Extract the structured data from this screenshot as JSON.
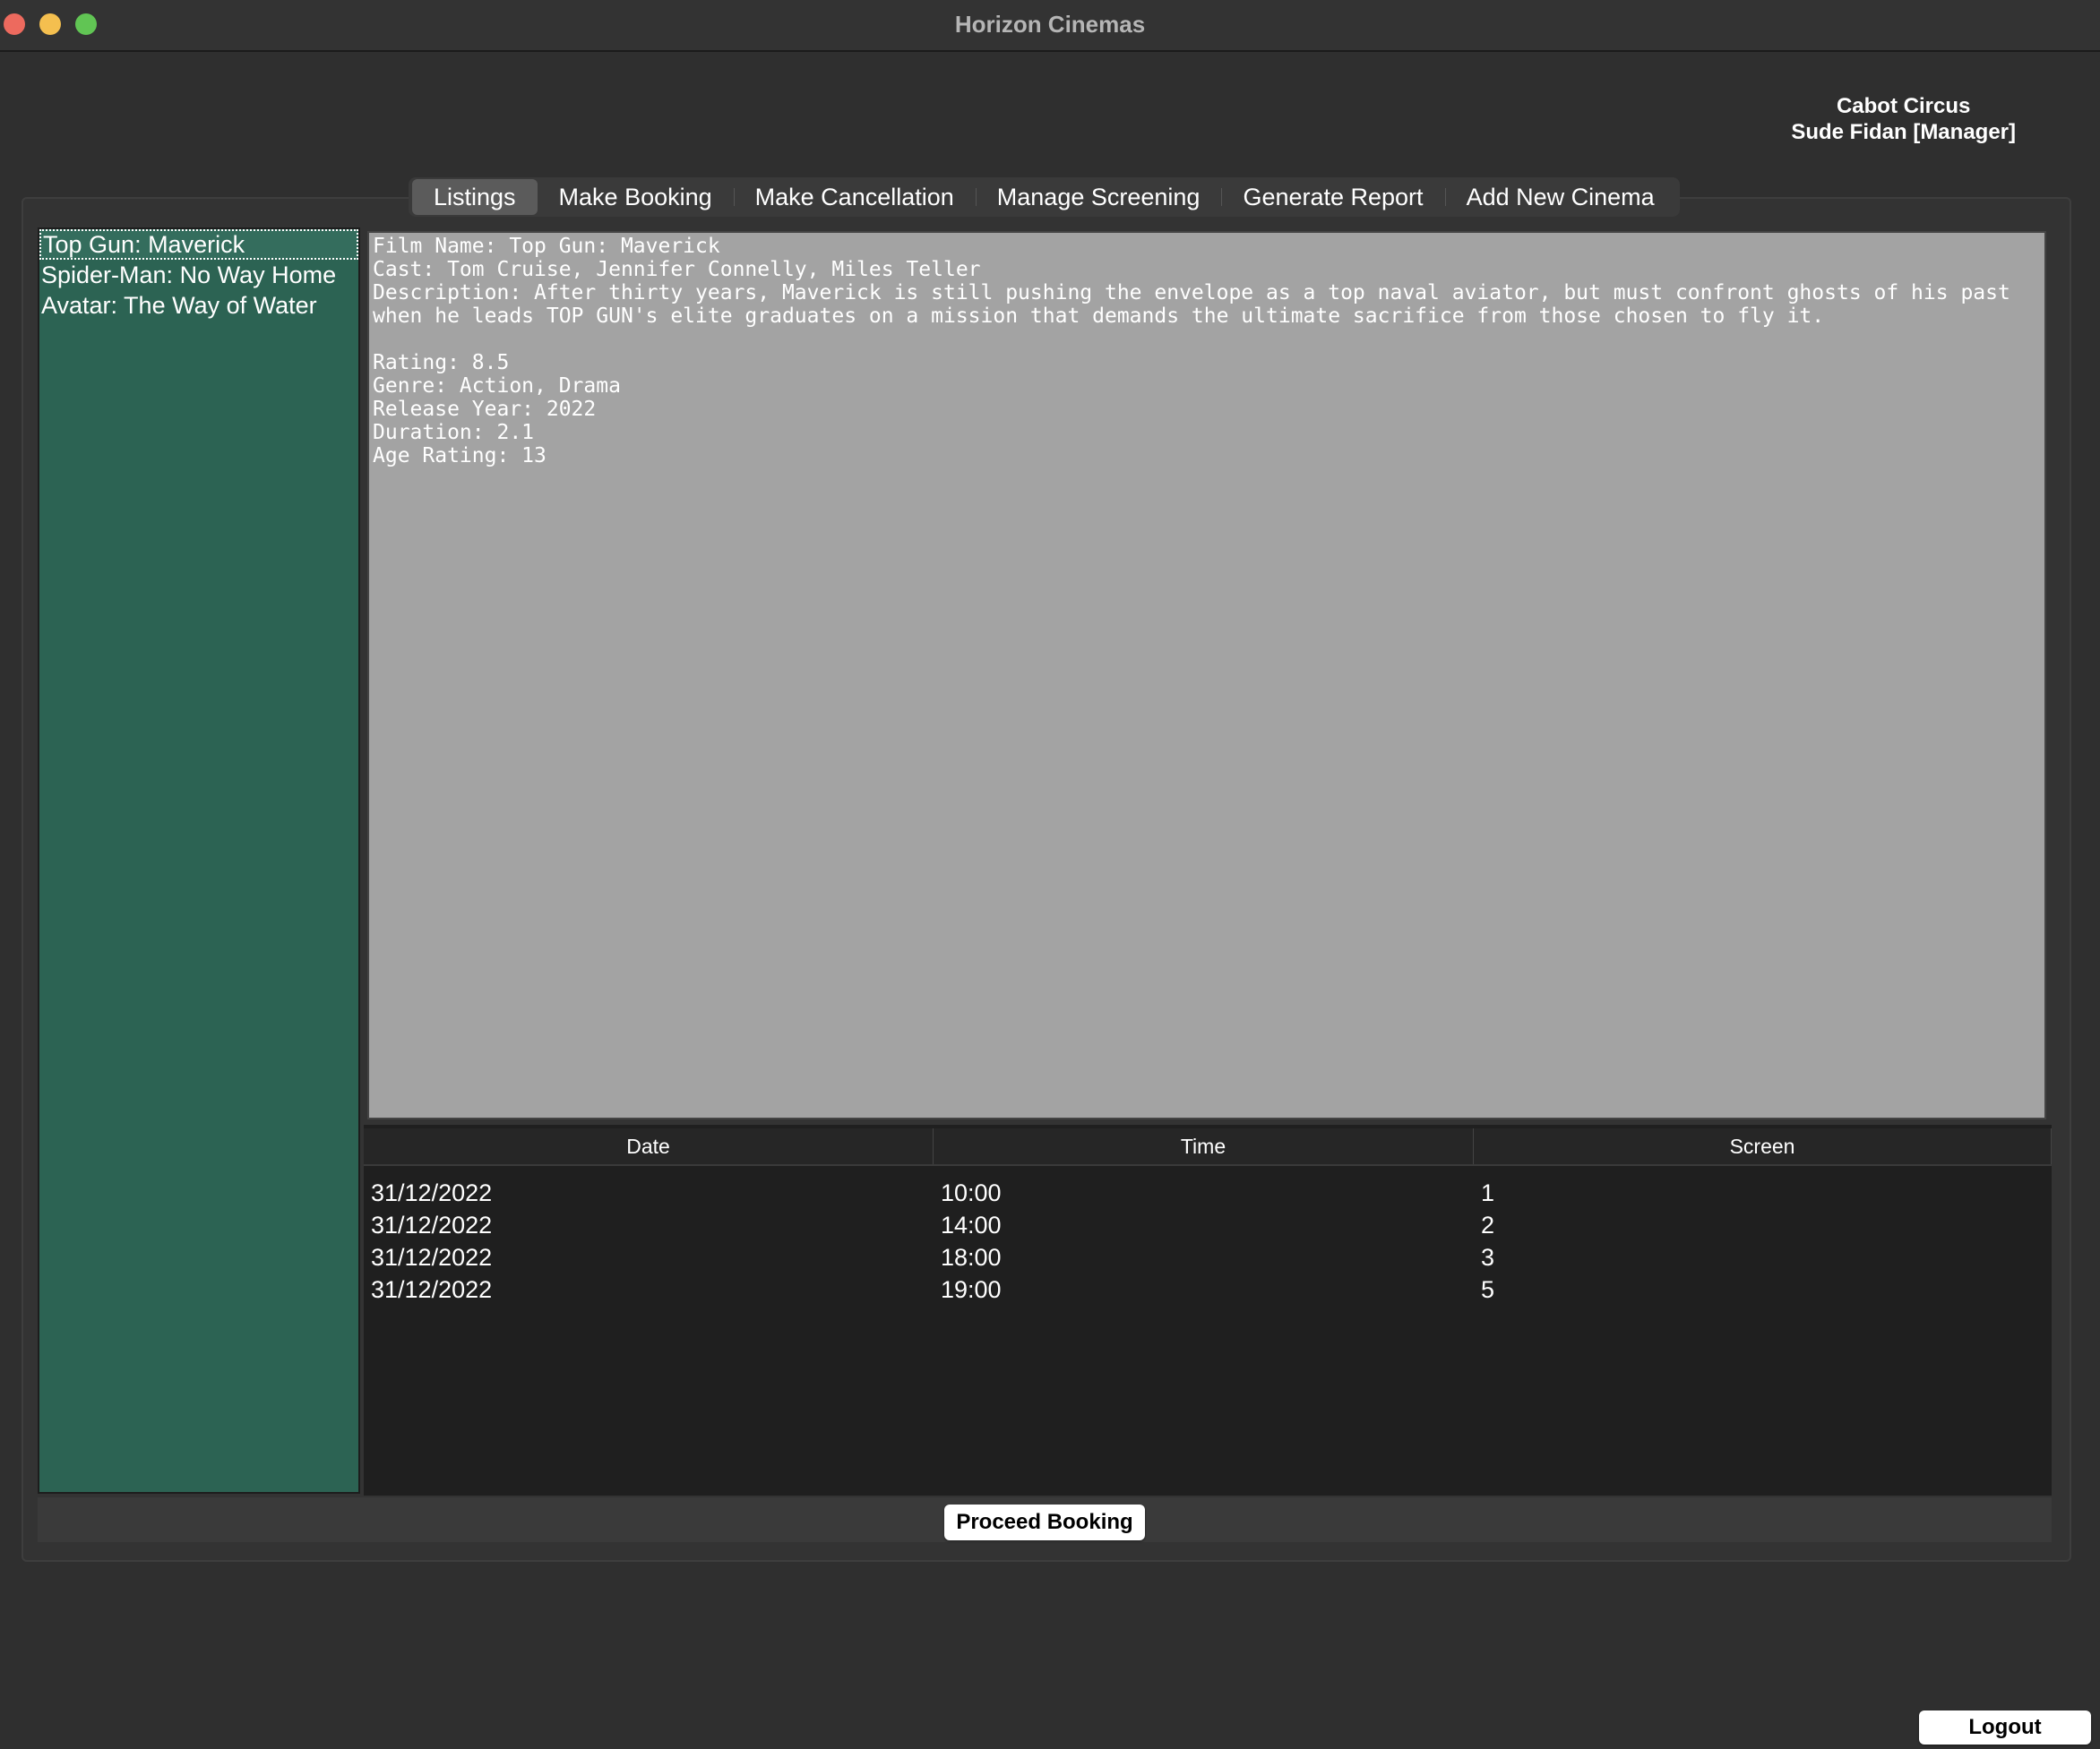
{
  "window": {
    "title": "Horizon Cinemas"
  },
  "user_info": {
    "cinema": "Cabot Circus",
    "user": "Sude Fidan [Manager]"
  },
  "tabs": [
    {
      "label": "Listings",
      "active": true
    },
    {
      "label": "Make Booking",
      "active": false
    },
    {
      "label": "Make Cancellation",
      "active": false
    },
    {
      "label": "Manage Screening",
      "active": false
    },
    {
      "label": "Generate Report",
      "active": false
    },
    {
      "label": "Add New Cinema",
      "active": false
    }
  ],
  "films": [
    {
      "title": "Top Gun: Maverick",
      "selected": true
    },
    {
      "title": "Spider-Man: No Way Home",
      "selected": false
    },
    {
      "title": "Avatar: The Way of Water",
      "selected": false
    }
  ],
  "details": {
    "lines": [
      "Film Name: Top Gun: Maverick",
      "Cast: Tom Cruise, Jennifer Connelly, Miles Teller",
      "Description: After thirty years, Maverick is still pushing the envelope as a top naval aviator, but must confront ghosts of his past when he leads TOP GUN's elite graduates on a mission that demands the ultimate sacrifice from those chosen to fly it.",
      "",
      "Rating: 8.5",
      "Genre: Action, Drama",
      "Release Year: 2022",
      "Duration: 2.1",
      "Age Rating: 13"
    ]
  },
  "screenings": {
    "columns": [
      "Date",
      "Time",
      "Screen"
    ],
    "rows": [
      [
        "31/12/2022",
        "10:00",
        "1"
      ],
      [
        "31/12/2022",
        "14:00",
        "2"
      ],
      [
        "31/12/2022",
        "18:00",
        "3"
      ],
      [
        "31/12/2022",
        "19:00",
        "5"
      ]
    ]
  },
  "buttons": {
    "proceed": "Proceed Booking",
    "logout": "Logout"
  },
  "colors": {
    "window_bg": "#2f2f2f",
    "list_bg": "#2c6353",
    "details_bg": "#a3a3a3",
    "table_bg": "#1f1f1f",
    "close": "#ed6a5e",
    "minimize": "#f4bf4f",
    "maximize": "#61c554"
  }
}
